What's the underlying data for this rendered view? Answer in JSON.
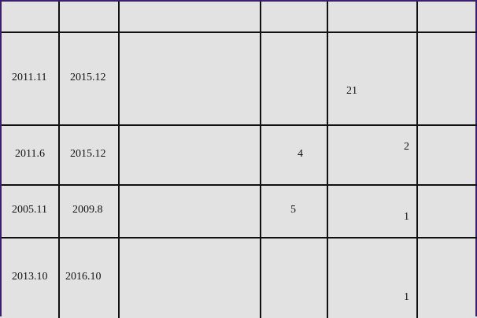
{
  "table": {
    "rows": [
      {
        "start": "2011.11",
        "end": "2015.12",
        "col5": "21"
      },
      {
        "start": "2011.6",
        "end": "2015.12",
        "col4": "4",
        "col5": "2"
      },
      {
        "start": "2005.11",
        "end": "2009.8",
        "col4": "5",
        "col5": "1"
      },
      {
        "start": "2013.10",
        "end": "2016.10",
        "col5": "1"
      }
    ]
  }
}
